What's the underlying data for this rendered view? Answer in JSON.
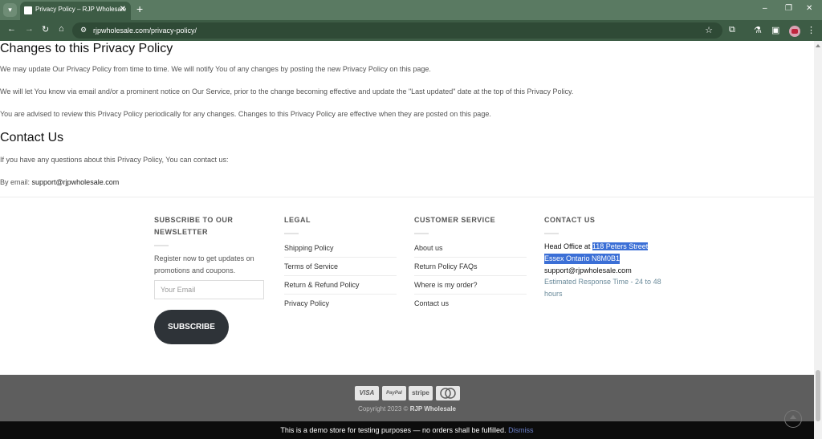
{
  "browser": {
    "tab_title": "Privacy Policy – RJP Wholesale",
    "url": "rjpwholesale.com/privacy-policy/",
    "tab_close": "✕",
    "new_tab": "+",
    "minimize": "–",
    "restore": "❐",
    "close": "✕"
  },
  "content": {
    "changes_heading": "Changes to this Privacy Policy",
    "changes_p1": "We may update Our Privacy Policy from time to time. We will notify You of any changes by posting the new Privacy Policy on this page.",
    "changes_p2": "We will let You know via email and/or a prominent notice on Our Service, prior to the change becoming effective and update the \"Last updated\" date at the top of this Privacy Policy.",
    "changes_p3": "You are advised to review this Privacy Policy periodically for any changes. Changes to this Privacy Policy are effective when they are posted on this page.",
    "contact_heading": "Contact Us",
    "contact_p1": "If you have any questions about this Privacy Policy, You can contact us:",
    "contact_email_prefix": "By email: ",
    "contact_email": "support@rjpwholesale.com"
  },
  "footer": {
    "newsletter": {
      "title": "SUBSCRIBE TO OUR NEWSLETTER",
      "text": "Register now to get updates on promotions and coupons.",
      "email_placeholder": "Your Email",
      "button": "SUBSCRIBE"
    },
    "legal": {
      "title": "LEGAL",
      "items": [
        "Shipping Policy",
        "Terms of Service",
        "Return & Refund Policy",
        "Privacy Policy"
      ]
    },
    "customer_service": {
      "title": "CUSTOMER SERVICE",
      "items": [
        "About us",
        "Return Policy FAQs",
        "Where is my order?",
        "Contact us"
      ]
    },
    "contact": {
      "title": "CONTACT US",
      "head_office_label": "Head Office at ",
      "address_line1": "118 Peters Street",
      "address_line2": "Essex Ontario N8M0B1",
      "email": "support@rjpwholesale.com",
      "response_time": "Estimated Response Time - 24 to 48 hours"
    },
    "payments": [
      "VISA",
      "PayPal",
      "stripe",
      "mastercard"
    ],
    "copyright_prefix": "Copyright 2023 © ",
    "copyright_brand": "RJP Wholesale"
  },
  "demo_notice": {
    "text": "This is a demo store for testing purposes — no orders shall be fulfilled. ",
    "dismiss": "Dismiss"
  }
}
